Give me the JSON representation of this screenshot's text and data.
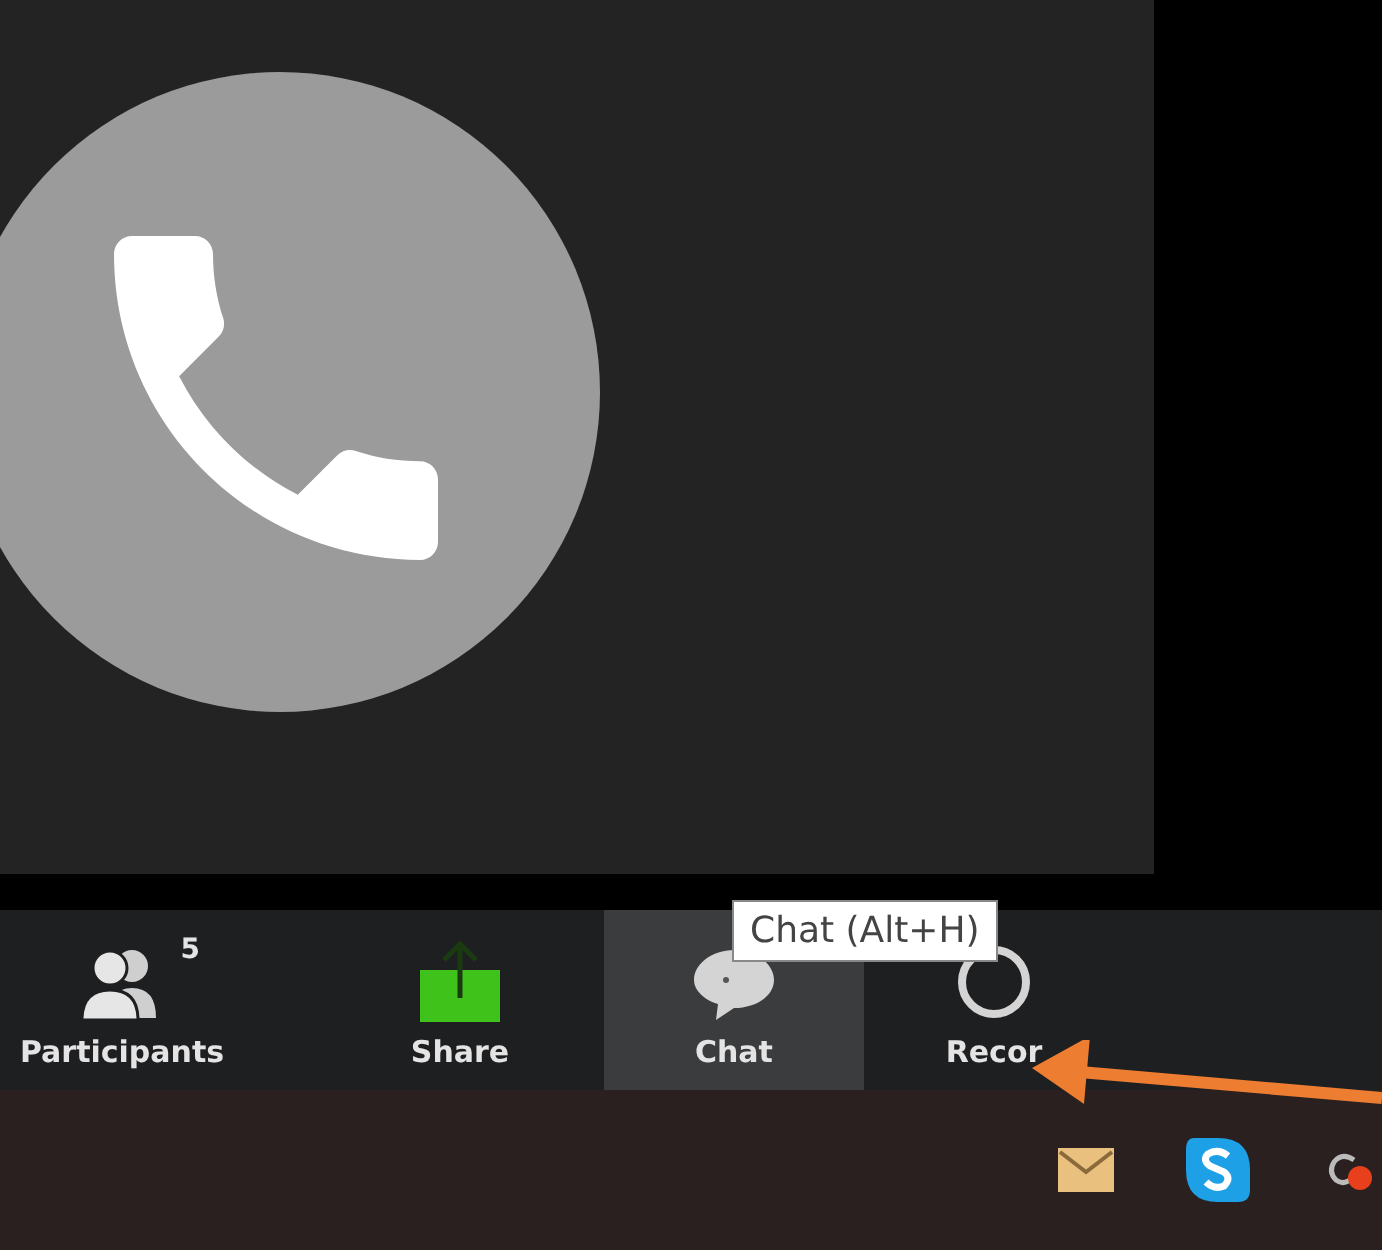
{
  "toolbar": {
    "buttons": [
      {
        "kind": "participants",
        "label": "Participants",
        "badge": "5",
        "selected": false
      },
      {
        "kind": "share",
        "label": "Share",
        "selected": false
      },
      {
        "kind": "chat",
        "label": "Chat",
        "selected": true
      },
      {
        "kind": "record",
        "label": "Recor",
        "selected": false
      }
    ]
  },
  "tooltip": {
    "text": "Chat (Alt+H)"
  }
}
